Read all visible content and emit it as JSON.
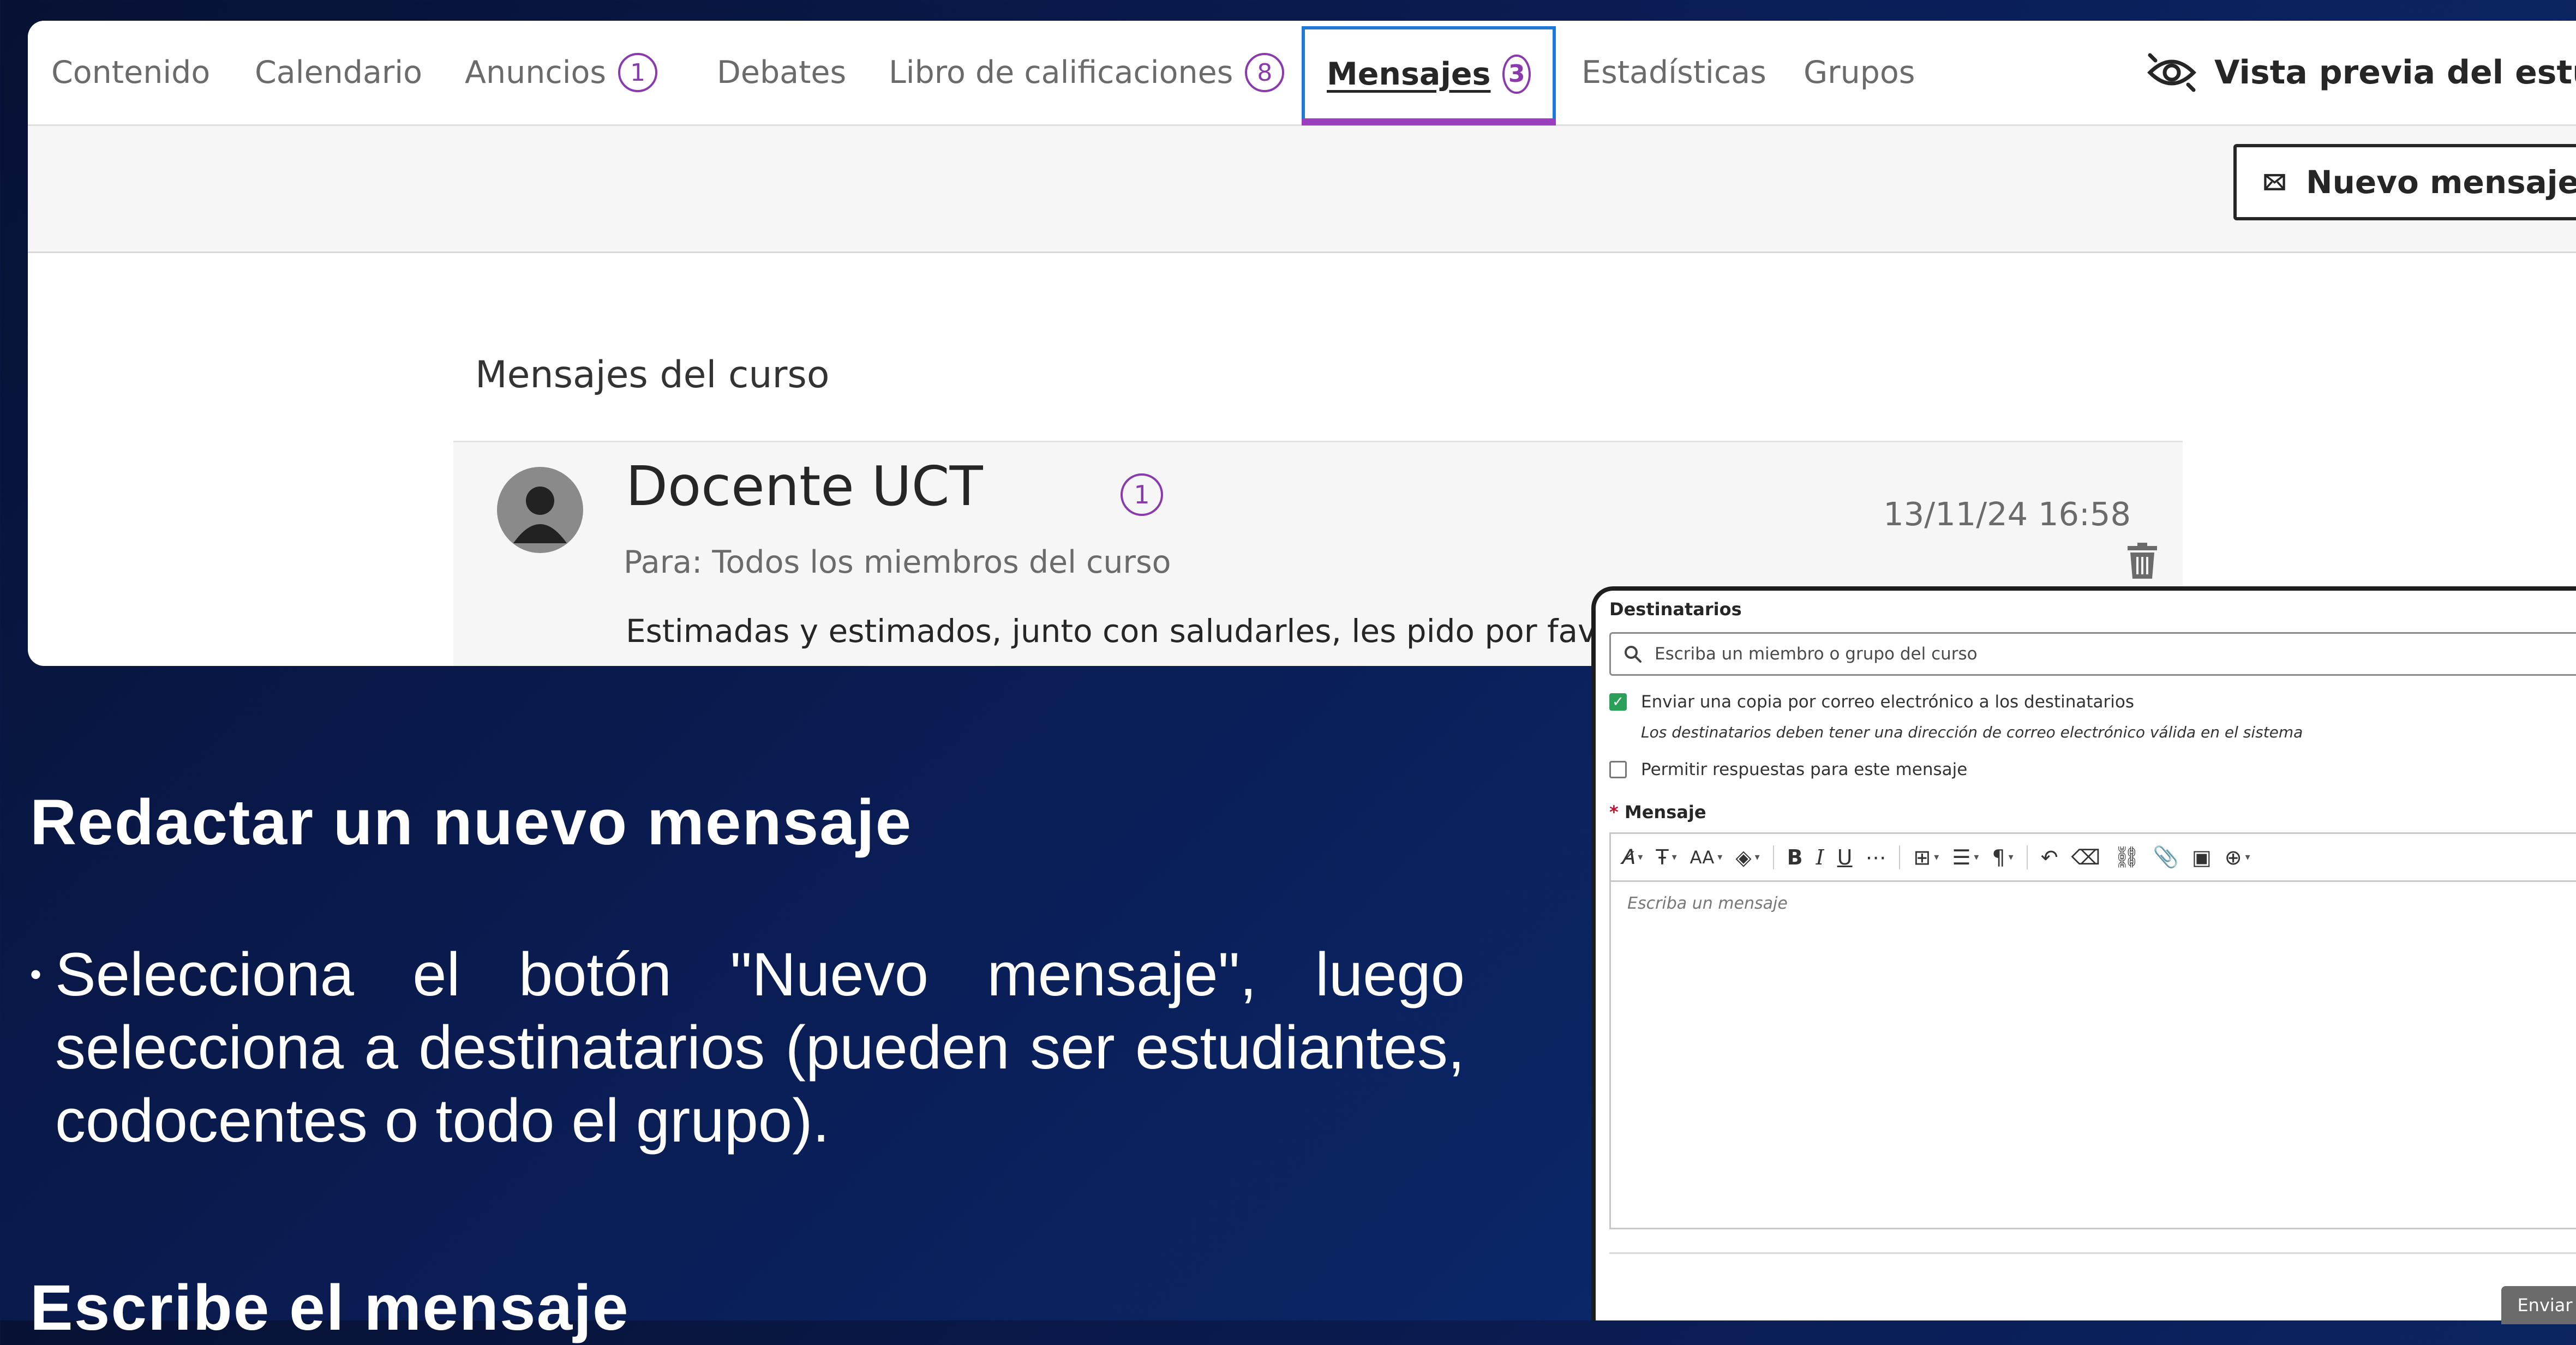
{
  "tabs": {
    "content": "Contenido",
    "calendar": "Calendario",
    "announcements": "Anuncios",
    "announcements_count": "1",
    "discussions": "Debates",
    "gradebook": "Libro de calificaciones",
    "gradebook_count": "8",
    "messages": "Mensajes",
    "messages_count": "3",
    "analytics": "Estadísticas",
    "groups": "Grupos",
    "student_preview": "Vista previa del estudiante"
  },
  "toolbar": {
    "new_message": "Nuevo mensaje"
  },
  "messages": {
    "section_title": "Mensajes del curso",
    "item": {
      "sender": "Docente UCT",
      "unread_count": "1",
      "recipients": "Para: Todos los miembros del curso",
      "date": "13/11/24 16:58",
      "preview": "Estimadas y estimados, junto con saludarles, les pido por favor que t"
    }
  },
  "slide": {
    "heading1": "Redactar un nuevo mensaje",
    "bullet": "Selecciona el botón \"Nuevo mensaje\", luego selecciona a destinatarios  (pueden ser estudiantes, codocentes o todo el grupo).",
    "heading2": "Escribe el mensaje"
  },
  "compose": {
    "recipients_label": "Destinatarios",
    "recipients_placeholder": "Escriba un miembro o grupo del curso",
    "email_copy_label": "Enviar una copia por correo electrónico a los destinatarios",
    "email_copy_checked": true,
    "email_note": "Los destinatarios deben tener una dirección de correo electrónico válida en el sistema",
    "allow_replies_label": "Permitir respuestas para este mensaje",
    "allow_replies_checked": false,
    "required_mark": "*",
    "message_label": "Mensaje",
    "message_placeholder": "Escriba un mensaje",
    "send": "Enviar"
  },
  "colors": {
    "accent_purple": "#9b3fc0",
    "focus_blue": "#2079d6",
    "checkbox_green": "#2aa05a",
    "slide_background": "#0a1d55"
  }
}
